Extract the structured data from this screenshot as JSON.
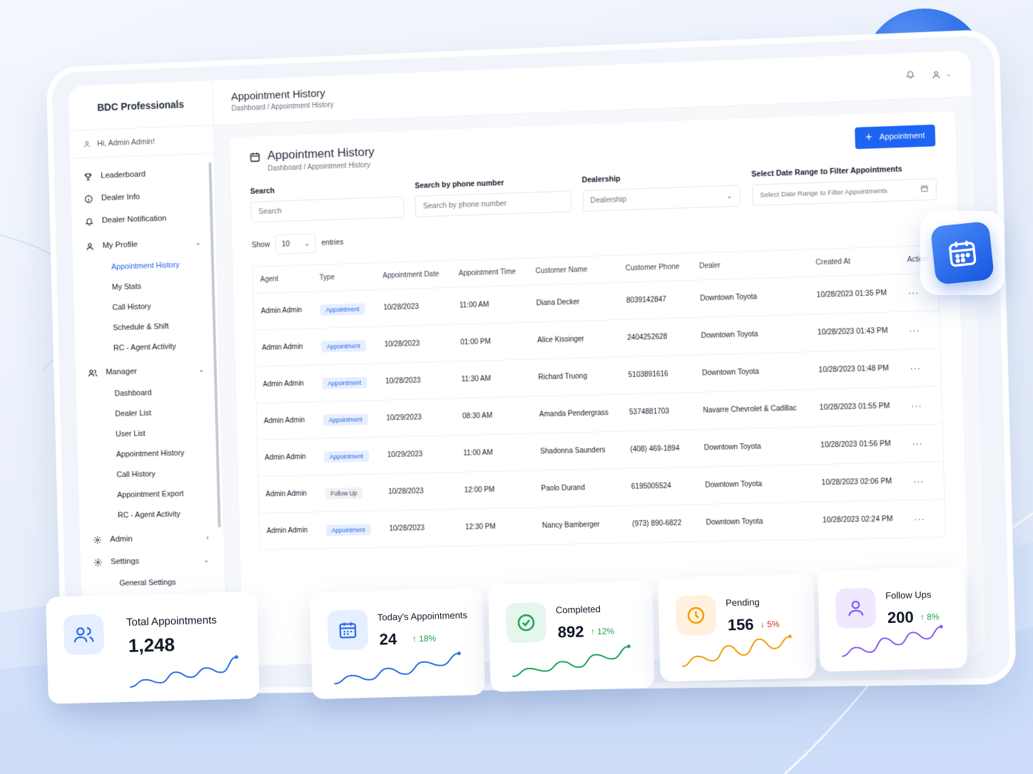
{
  "app": {
    "brand": "BDC Professionals",
    "greeting": "Hi, Admin Admin!"
  },
  "sidebar": {
    "items": [
      {
        "label": "Leaderboard",
        "icon": "trophy-icon"
      },
      {
        "label": "Dealer Info",
        "icon": "info-icon"
      },
      {
        "label": "Dealer Notification",
        "icon": "bell-icon"
      }
    ],
    "my_profile": {
      "label": "My Profile",
      "sub": [
        "Appointment History",
        "My Stats",
        "Call History",
        "Schedule & Shift",
        "RC - Agent Activity"
      ]
    },
    "manager": {
      "label": "Manager",
      "sub": [
        "Dashboard",
        "Dealer List",
        "User List",
        "Appointment History",
        "Call History",
        "Appointment Export",
        "RC - Agent Activity"
      ]
    },
    "admin": {
      "label": "Admin"
    },
    "settings": {
      "label": "Settings",
      "sub": [
        "General Settings"
      ]
    }
  },
  "topbar": {
    "title": "Appointment History",
    "breadcrumb": "Dashboard / Appointment History"
  },
  "card": {
    "title": "Appointment History",
    "breadcrumb": "Dashboard / Appointment History",
    "add_button": "Appointment"
  },
  "filters": {
    "search": {
      "label": "Search",
      "placeholder": "Search"
    },
    "phone": {
      "label": "Search by phone number",
      "placeholder": "Search by phone number"
    },
    "dealership": {
      "label": "Dealership",
      "placeholder": "Dealership"
    },
    "date": {
      "label": "Select Date Range to Filter Appointments",
      "placeholder": "Select Date Range to Filter Appointments"
    }
  },
  "entries": {
    "show": "Show",
    "value": "10",
    "suffix": "entries"
  },
  "table": {
    "columns": [
      "Agent",
      "Type",
      "Appointment Date",
      "Appointment Time",
      "Customer Name",
      "Customer Phone",
      "Dealer",
      "Created At",
      "Action"
    ],
    "rows": [
      [
        "Admin Admin",
        "Appointment",
        "10/28/2023",
        "11:00 AM",
        "Diana Decker",
        "8039142847",
        "Downtown Toyota",
        "10/28/2023 01:35 PM",
        "···"
      ],
      [
        "Admin Admin",
        "Appointment",
        "10/28/2023",
        "01:00 PM",
        "Alice Kissinger",
        "2404252628",
        "Downtown Toyota",
        "10/28/2023 01:43 PM",
        "···"
      ],
      [
        "Admin Admin",
        "Appointment",
        "10/28/2023",
        "11:30 AM",
        "Richard Truong",
        "5103891616",
        "Downtown Toyota",
        "10/28/2023 01:48 PM",
        "···"
      ],
      [
        "Admin Admin",
        "Appointment",
        "10/29/2023",
        "08:30 AM",
        "Amanda Pendergrass",
        "5374881703",
        "Navarre Chevrolet & Cadillac",
        "10/28/2023 01:55 PM",
        "···"
      ],
      [
        "Admin Admin",
        "Appointment",
        "10/29/2023",
        "11:00 AM",
        "Shadonna Saunders",
        "(408) 469-1894",
        "Downtown Toyota",
        "10/28/2023 01:56 PM",
        "···"
      ],
      [
        "Admin Admin",
        "Follow Up",
        "10/28/2023",
        "12:00 PM",
        "Paolo Durand",
        "6195005524",
        "Downtown Toyota",
        "10/28/2023 02:06 PM",
        "···"
      ],
      [
        "Admin Admin",
        "Appointment",
        "10/28/2023",
        "12:30 PM",
        "Nancy Bamberger",
        "(973) 890-6822",
        "Downtown Toyota",
        "10/28/2023 02:24 PM",
        "···"
      ]
    ]
  },
  "stats": [
    {
      "label": "Total Appointments",
      "value": "1,248",
      "delta": "",
      "direction": "",
      "icon": "users-icon",
      "color": "#2f6fe4",
      "bg": "#e6efff",
      "trend": [
        2,
        3,
        2.5,
        4,
        3.2,
        4.5,
        3.8,
        6
      ]
    },
    {
      "label": "Today's Appointments",
      "value": "24",
      "delta": "18%",
      "direction": "up",
      "icon": "calendar-icon",
      "color": "#2f6fe4",
      "bg": "#e6efff",
      "trend": [
        2,
        3,
        2.4,
        3.8,
        3,
        4.5,
        4,
        5.5
      ]
    },
    {
      "label": "Completed",
      "value": "892",
      "delta": "12%",
      "direction": "up",
      "icon": "check-circle-icon",
      "color": "#22a55b",
      "bg": "#e5f6ec",
      "trend": [
        2,
        3,
        2.6,
        3.8,
        3,
        4.6,
        4,
        5.6
      ]
    },
    {
      "label": "Pending",
      "value": "156",
      "delta": "5%",
      "direction": "down",
      "icon": "clock-icon",
      "color": "#f59e0b",
      "bg": "#fff1de",
      "trend": [
        2,
        3,
        2.5,
        4,
        3,
        4.6,
        3.6,
        4.8
      ]
    },
    {
      "label": "Follow Ups",
      "value": "200",
      "delta": "8%",
      "direction": "up",
      "icon": "person-icon",
      "color": "#8b5cf6",
      "bg": "#efe8ff",
      "trend": [
        2,
        3,
        2.4,
        4,
        3.2,
        4.6,
        3.8,
        5.2
      ]
    }
  ]
}
